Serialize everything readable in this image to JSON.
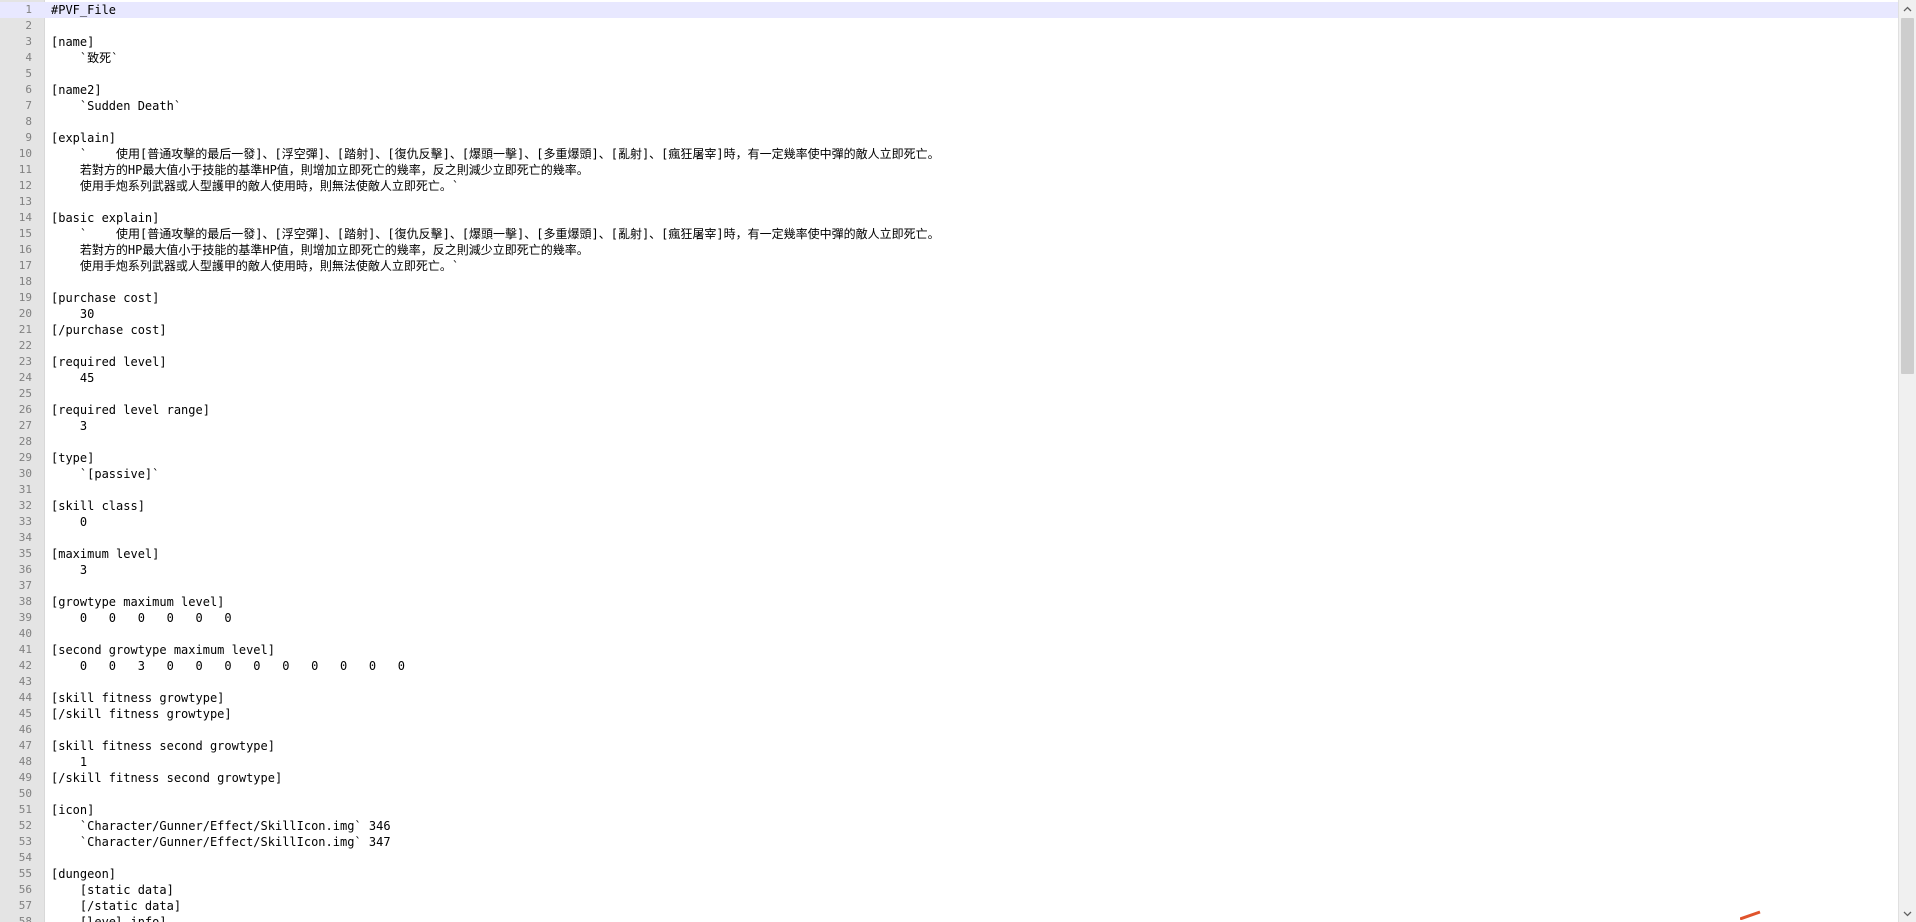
{
  "editor": {
    "current_line": 1,
    "lines": [
      {
        "n": "1",
        "text": "#PVF_File"
      },
      {
        "n": "2",
        "text": ""
      },
      {
        "n": "3",
        "text": "[name]"
      },
      {
        "n": "4",
        "text": "    `致死`"
      },
      {
        "n": "5",
        "text": ""
      },
      {
        "n": "6",
        "text": "[name2]"
      },
      {
        "n": "7",
        "text": "    `Sudden Death`"
      },
      {
        "n": "8",
        "text": ""
      },
      {
        "n": "9",
        "text": "[explain]"
      },
      {
        "n": "10",
        "text": "    `    使用[普通攻擊的最后一發]、[浮空彈]、[踏射]、[復仇反擊]、[爆頭一擊]、[多重爆頭]、[亂射]、[瘋狂屠宰]時，有一定幾率使中彈的敵人立即死亡。"
      },
      {
        "n": "11",
        "text": "    若對方的HP最大值小于技能的基準HP值，則增加立即死亡的幾率，反之則減少立即死亡的幾率。"
      },
      {
        "n": "12",
        "text": "    使用手炮系列武器或人型護甲的敵人使用時，則無法使敵人立即死亡。`"
      },
      {
        "n": "13",
        "text": ""
      },
      {
        "n": "14",
        "text": "[basic explain]"
      },
      {
        "n": "15",
        "text": "    `    使用[普通攻擊的最后一發]、[浮空彈]、[踏射]、[復仇反擊]、[爆頭一擊]、[多重爆頭]、[亂射]、[瘋狂屠宰]時，有一定幾率使中彈的敵人立即死亡。"
      },
      {
        "n": "16",
        "text": "    若對方的HP最大值小于技能的基準HP值，則增加立即死亡的幾率，反之則減少立即死亡的幾率。"
      },
      {
        "n": "17",
        "text": "    使用手炮系列武器或人型護甲的敵人使用時，則無法使敵人立即死亡。`"
      },
      {
        "n": "18",
        "text": ""
      },
      {
        "n": "19",
        "text": "[purchase cost]"
      },
      {
        "n": "20",
        "text": "    30"
      },
      {
        "n": "21",
        "text": "[/purchase cost]"
      },
      {
        "n": "22",
        "text": ""
      },
      {
        "n": "23",
        "text": "[required level]"
      },
      {
        "n": "24",
        "text": "    45"
      },
      {
        "n": "25",
        "text": ""
      },
      {
        "n": "26",
        "text": "[required level range]"
      },
      {
        "n": "27",
        "text": "    3"
      },
      {
        "n": "28",
        "text": ""
      },
      {
        "n": "29",
        "text": "[type]"
      },
      {
        "n": "30",
        "text": "    `[passive]`"
      },
      {
        "n": "31",
        "text": ""
      },
      {
        "n": "32",
        "text": "[skill class]"
      },
      {
        "n": "33",
        "text": "    0"
      },
      {
        "n": "34",
        "text": ""
      },
      {
        "n": "35",
        "text": "[maximum level]"
      },
      {
        "n": "36",
        "text": "    3"
      },
      {
        "n": "37",
        "text": ""
      },
      {
        "n": "38",
        "text": "[growtype maximum level]"
      },
      {
        "n": "39",
        "text": "    0   0   0   0   0   0"
      },
      {
        "n": "40",
        "text": ""
      },
      {
        "n": "41",
        "text": "[second growtype maximum level]"
      },
      {
        "n": "42",
        "text": "    0   0   3   0   0   0   0   0   0   0   0   0"
      },
      {
        "n": "43",
        "text": ""
      },
      {
        "n": "44",
        "text": "[skill fitness growtype]"
      },
      {
        "n": "45",
        "text": "[/skill fitness growtype]"
      },
      {
        "n": "46",
        "text": ""
      },
      {
        "n": "47",
        "text": "[skill fitness second growtype]"
      },
      {
        "n": "48",
        "text": "    1"
      },
      {
        "n": "49",
        "text": "[/skill fitness second growtype]"
      },
      {
        "n": "50",
        "text": ""
      },
      {
        "n": "51",
        "text": "[icon]"
      },
      {
        "n": "52",
        "text": "    `Character/Gunner/Effect/SkillIcon.img` 346"
      },
      {
        "n": "53",
        "text": "    `Character/Gunner/Effect/SkillIcon.img` 347"
      },
      {
        "n": "54",
        "text": ""
      },
      {
        "n": "55",
        "text": "[dungeon]"
      },
      {
        "n": "56",
        "text": "    [static data]"
      },
      {
        "n": "57",
        "text": "    [/static data]"
      },
      {
        "n": "58",
        "text": "    [level info]"
      }
    ]
  },
  "icons": {
    "scroll_up": "chevron-up-icon",
    "scroll_down": "chevron-down-icon"
  },
  "colors": {
    "gutter_bg": "#e4e4e4",
    "line_number": "#808080",
    "current_line_bg": "#e8e8ff",
    "marker": "#e0542c"
  }
}
